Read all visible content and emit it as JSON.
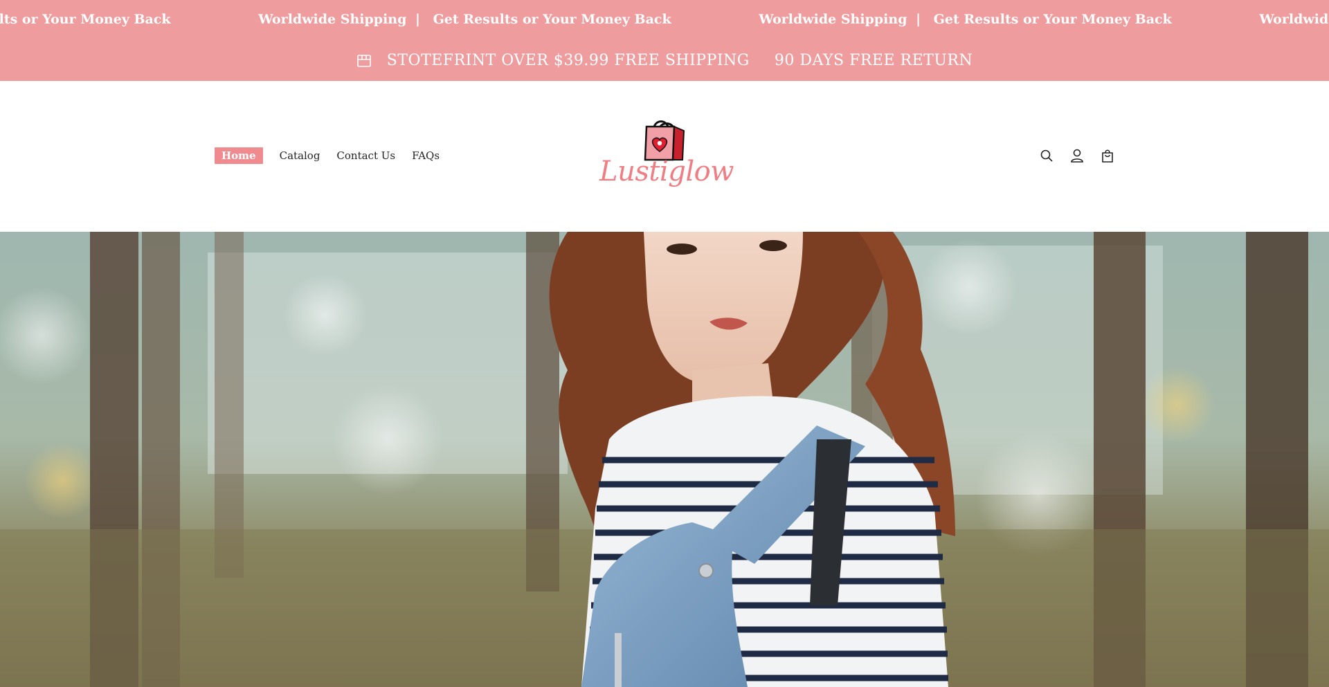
{
  "ticker": {
    "partial_text": "esults or Your Money Back",
    "shipping_text": "Worldwide Shipping",
    "separator": "|",
    "results_text": "Get Results or Your Money Back",
    "tail_text": "Worldwid"
  },
  "promo": {
    "icon": "store-icon",
    "free_shipping": "STOTEFRINT OVER $39.99 FREE SHIPPING",
    "free_return": "90 DAYS FREE RETURN"
  },
  "nav": {
    "items": [
      {
        "label": "Home",
        "active": true
      },
      {
        "label": "Catalog",
        "active": false
      },
      {
        "label": "Contact Us",
        "active": false
      },
      {
        "label": "FAQs",
        "active": false
      }
    ]
  },
  "logo": {
    "text": "Lustiglow",
    "icon": "shopping-bag-heart-logo"
  },
  "header_icons": {
    "search": "search-icon",
    "account": "user-icon",
    "cart": "cart-bag-icon"
  },
  "hero": {
    "image": "woman-in-striped-shirt-and-denim-overalls-in-forest"
  },
  "colors": {
    "accent": "#ef9c9e",
    "nav_active": "#ef8a8e",
    "logo_pink": "#ef7e84",
    "bag_red": "#e84a5a",
    "text_dark": "#222222"
  }
}
